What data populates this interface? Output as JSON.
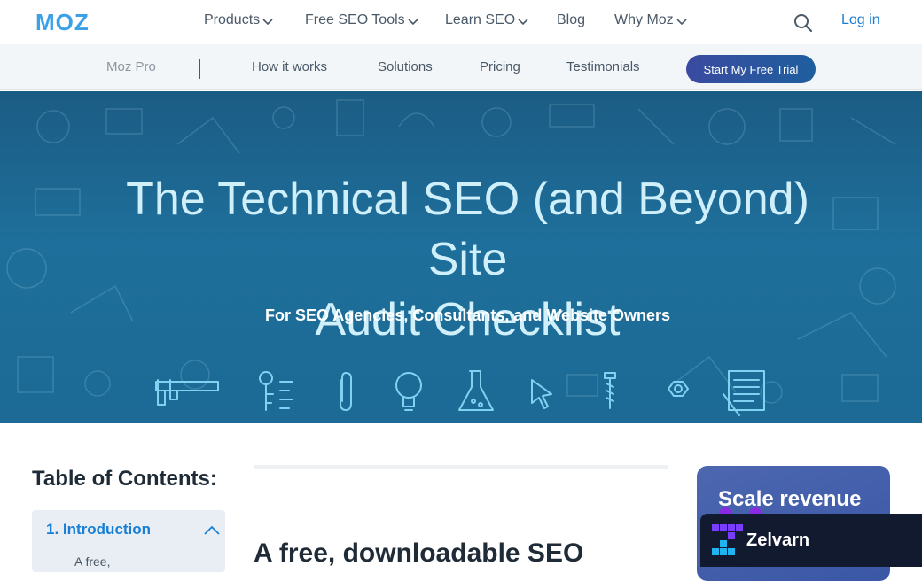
{
  "topnav": {
    "logo": "MOZ",
    "items": [
      {
        "label": "Products"
      },
      {
        "label": "Free SEO Tools"
      },
      {
        "label": "Learn SEO"
      },
      {
        "label": "Blog"
      },
      {
        "label": "Why Moz"
      }
    ],
    "login": "Log in"
  },
  "subnav": {
    "brand": "Moz Pro",
    "items": [
      "How it works",
      "Solutions",
      "Pricing",
      "Testimonials"
    ],
    "cta": "Start My Free Trial"
  },
  "hero": {
    "title_line1": "The Technical SEO (and Beyond) Site",
    "title_line2": "Audit Checklist",
    "subtitle": "For SEO Agencies, Consultants, and Website Owners",
    "icons": [
      "caliper-icon",
      "key-icon",
      "paperclip-icon",
      "lightbulb-icon",
      "flask-icon",
      "cursor-icon",
      "screw-icon",
      "nut-icon",
      "notepad-icon"
    ]
  },
  "toc": {
    "title": "Table of Contents:",
    "item": "1. Introduction",
    "sub": "A free,"
  },
  "main": {
    "heading": "A free, downloadable SEO"
  },
  "promo": {
    "text": "Scale revenue"
  },
  "widget": {
    "name": "Zelvarn"
  },
  "colors": {
    "accent": "#1a7fd4",
    "hero": "#1e6f9b",
    "cta": "#3a4aa0"
  }
}
